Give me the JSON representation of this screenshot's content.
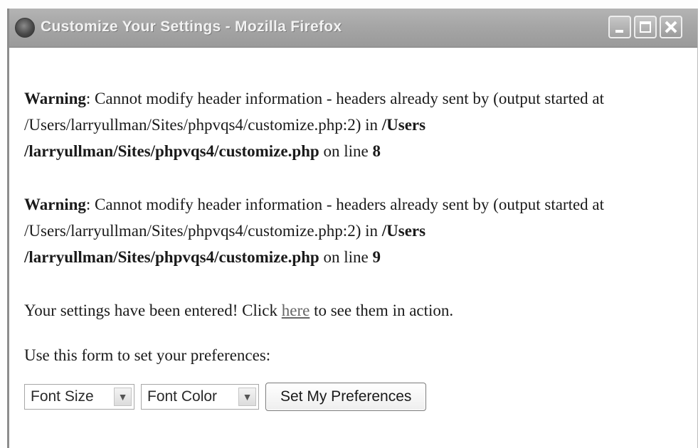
{
  "window": {
    "title": "Customize Your Settings - Mozilla Firefox",
    "controls": {
      "minimize": "minimize",
      "maximize": "maximize",
      "close": "close"
    }
  },
  "warnings": [
    {
      "label": "Warning",
      "text": ": Cannot modify header information - headers already sent by (output started at /Users/larryullman/Sites/phpvqs4/customize.php:2) in ",
      "file": "/Users /larryullman/Sites/phpvqs4/customize.php",
      "line_text": " on line ",
      "line": "8"
    },
    {
      "label": "Warning",
      "text": ": Cannot modify header information - headers already sent by (output started at /Users/larryullman/Sites/phpvqs4/customize.php:2) in ",
      "file": "/Users /larryullman/Sites/phpvqs4/customize.php",
      "line_text": " on line ",
      "line": "9"
    }
  ],
  "message": {
    "before": "Your settings have been entered! Click ",
    "link": "here",
    "after": " to see them in action."
  },
  "form": {
    "prompt": "Use this form to set your preferences:",
    "font_size_select": "Font Size",
    "font_color_select": "Font Color",
    "submit_label": "Set My Preferences"
  },
  "icons": {
    "app": "firefox-icon",
    "dropdown": "chevron-down-icon"
  }
}
